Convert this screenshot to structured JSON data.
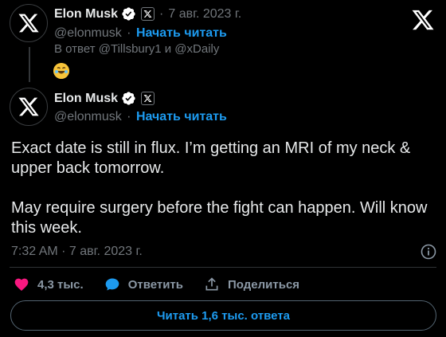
{
  "reply_tweet": {
    "author_name": "Elon Musk",
    "date": "7 авг. 2023 г.",
    "handle": "@elonmusk",
    "follow_label": "Начать читать",
    "reply_to": "В ответ @Tillsbury1 и @xDaily",
    "emoji": "rolling-on-floor-laughing"
  },
  "main_tweet": {
    "author_name": "Elon Musk",
    "handle": "@elonmusk",
    "follow_label": "Начать читать",
    "text_p1": "Exact date is still in flux. I’m getting an MRI of my neck & upper back tomorrow.",
    "text_p2": "May require surgery before the fight can happen. Will know this week.",
    "timestamp": "7:32 AM · 7 авг. 2023 г."
  },
  "actions": {
    "like_count": "4,3 тыс.",
    "reply_label": "Ответить",
    "share_label": "Поделиться"
  },
  "read_replies_label": "Читать 1,6 тыс. ответа",
  "icons": {
    "close": "x-logo-icon",
    "verified": "verified-badge-icon",
    "affiliate": "x-affiliate-badge-icon",
    "info": "info-icon",
    "like": "heart-icon",
    "reply": "comment-bubble-icon",
    "share": "share-upload-icon"
  },
  "colors": {
    "background": "#000000",
    "text": "#e7e9ea",
    "muted": "#71767b",
    "accent": "#1d9bf0",
    "like": "#f91880"
  }
}
